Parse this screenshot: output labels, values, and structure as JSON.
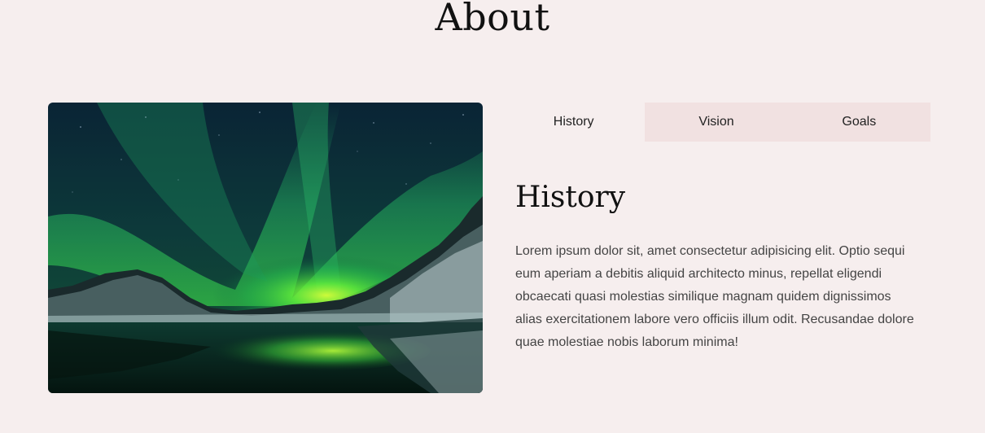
{
  "section": {
    "title": "About"
  },
  "image": {
    "description_icon": "aurora-landscape-photo"
  },
  "tabs": {
    "items": [
      {
        "label": "History",
        "active": true
      },
      {
        "label": "Vision",
        "active": false
      },
      {
        "label": "Goals",
        "active": false
      }
    ]
  },
  "panel": {
    "heading": "History",
    "body": "Lorem ipsum dolor sit, amet consectetur adipisicing elit. Optio sequi eum aperiam a debitis aliquid architecto minus, repellat eligendi obcaecati quasi molestias similique magnam quidem dignissimos alias exercitationem labore vero officiis illum odit. Recusandae dolore quae molestiae nobis laborum minima!"
  },
  "colors": {
    "page_background": "#f6eeee",
    "tab_inactive_background": "#f1e1e1",
    "aurora_green": "#39e83a",
    "sky_dark": "#0a2233"
  }
}
